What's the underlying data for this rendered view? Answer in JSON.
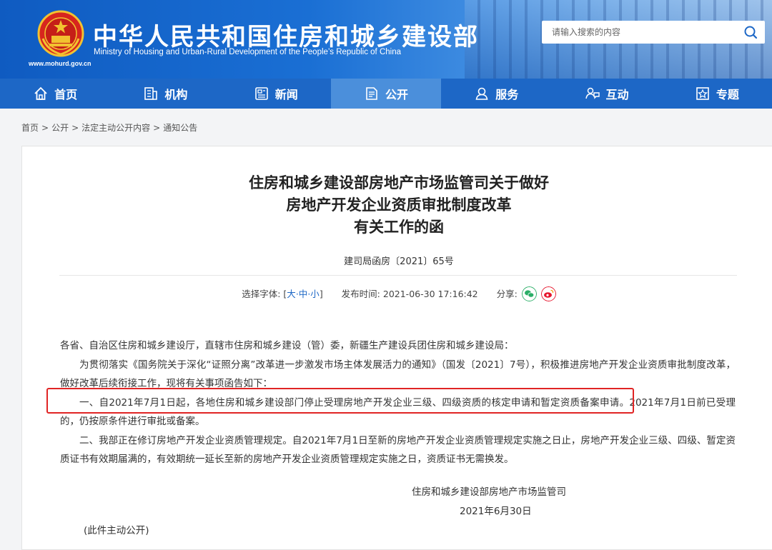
{
  "header": {
    "title": "中华人民共和国住房和城乡建设部",
    "subtitle": "Ministry of Housing and Urban-Rural Development of the People’s Republic of China",
    "url": "www.mohurd.gov.cn",
    "search_placeholder": "请输入搜索的内容"
  },
  "nav": {
    "items": [
      {
        "label": "首页",
        "icon": "home-icon"
      },
      {
        "label": "机构",
        "icon": "building-icon"
      },
      {
        "label": "新闻",
        "icon": "news-icon"
      },
      {
        "label": "公开",
        "icon": "document-icon",
        "active": true
      },
      {
        "label": "服务",
        "icon": "service-icon"
      },
      {
        "label": "互动",
        "icon": "chat-icon"
      },
      {
        "label": "专题",
        "icon": "topic-icon"
      }
    ]
  },
  "breadcrumb": [
    "首页",
    "公开",
    "法定主动公开内容",
    "通知公告"
  ],
  "article": {
    "title_line1": "住房和城乡建设部房地产市场监管司关于做好",
    "title_line2": "房地产开发企业资质审批制度改革",
    "title_line3": "有关工作的函",
    "doc_number": "建司局函房〔2021〕65号",
    "font_label": "选择字体:",
    "font_large": "大",
    "font_medium": "中",
    "font_small": "小",
    "publish_label": "发布时间:",
    "publish_time": "2021-06-30 17:16:42",
    "share_label": "分享:",
    "salutation": "各省、自治区住房和城乡建设厅，直辖市住房和城乡建设（管）委，新疆生产建设兵团住房和城乡建设局：",
    "para1": "为贯彻落实《国务院关于深化“证照分离”改革进一步激发市场主体发展活力的通知》（国发〔2021〕7号），积极推进房地产开发企业资质审批制度改革，做好改革后续衔接工作，现将有关事项函告如下：",
    "para2": "一、自2021年7月1日起，各地住房和城乡建设部门停止受理房地产开发企业三级、四级资质的核定申请和暂定资质备案申请。2021年7月1日前已受理的，仍按原条件进行审批或备案。",
    "para3": "二、我部正在修订房地产开发企业资质管理规定。自2021年7月1日至新的房地产开发企业资质管理规定实施之日止，房地产开发企业三级、四级、暂定资质证书有效期届满的，有效期统一延长至新的房地产开发企业资质管理规定实施之日，资质证书无需换发。",
    "signature": "住房和城乡建设部房地产市场监管司",
    "date": "2021年6月30日",
    "note": "(此件主动公开)"
  },
  "colors": {
    "nav_bg": "#1d67c6",
    "nav_active": "#4b8fdb",
    "highlight_border": "#e02424",
    "wechat": "#2aae67",
    "weibo": "#e6162d"
  }
}
